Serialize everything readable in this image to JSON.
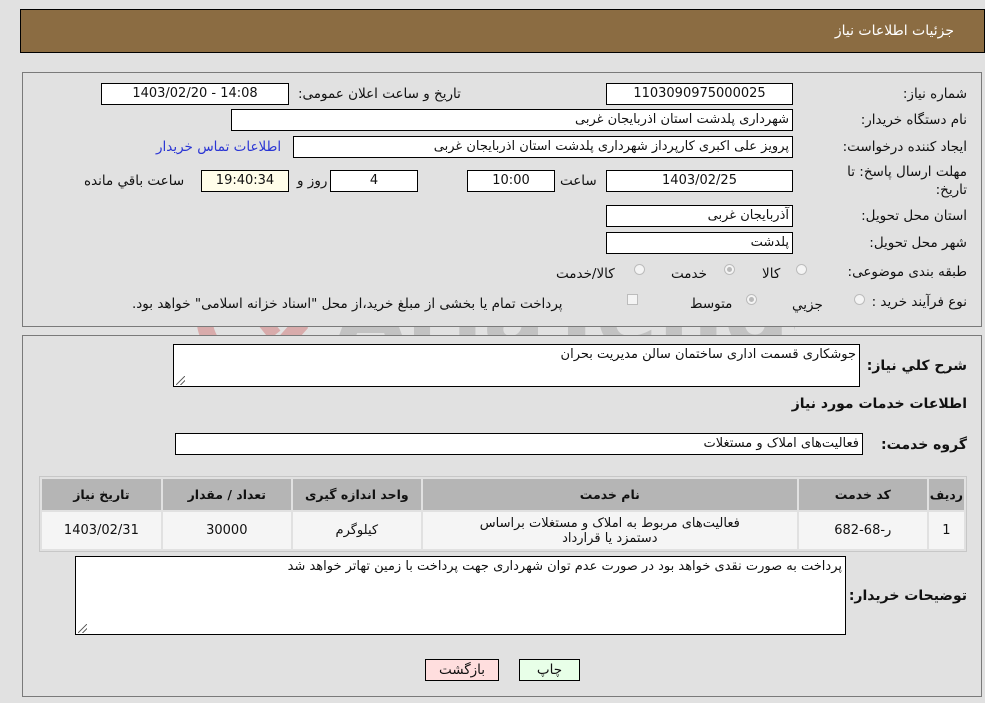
{
  "header": {
    "title": "جزئیات اطلاعات نیاز"
  },
  "form": {
    "need_number": {
      "label": "شماره نیاز:",
      "value": "1103090975000025"
    },
    "announce_datetime": {
      "label": "تاریخ و ساعت اعلان عمومی:",
      "value": "1403/02/20 - 14:08"
    },
    "buyer_org": {
      "label": "نام دستگاه خریدار:",
      "value": "شهرداری پلدشت استان اذربایجان غربی"
    },
    "requester": {
      "label": "ایجاد کننده درخواست:",
      "value": "پرویز علی اکبری کارپرداز شهرداری پلدشت استان اذربایجان غربی"
    },
    "buyer_contact_link": "اطلاعات تماس خریدار",
    "deadline": {
      "label": "مهلت ارسال پاسخ: تا تاریخ:",
      "date": "1403/02/25",
      "time_label": "ساعت",
      "time": "10:00",
      "days": "4",
      "days_label": "روز و",
      "remaining": "19:40:34",
      "remaining_label": "ساعت باقي مانده"
    },
    "province": {
      "label": "استان محل تحویل:",
      "value": "آذربایجان غربی"
    },
    "city": {
      "label": "شهر محل تحویل:",
      "value": "پلدشت"
    },
    "category": {
      "label": "طبقه بندی موضوعی:",
      "options": [
        "کالا",
        "خدمت",
        "کالا/خدمت"
      ],
      "selected": "خدمت"
    },
    "purchase_type": {
      "label": "نوع فرآیند خرید :",
      "options": [
        "جزيي",
        "متوسط"
      ],
      "selected": "متوسط",
      "treasury_note": "پرداخت تمام یا بخشی از مبلغ خرید،از محل \"اسناد خزانه اسلامی\" خواهد بود.",
      "treasury_checked": false
    }
  },
  "details": {
    "description_label": "شرح کلي نیاز:",
    "description": "جوشکاری قسمت اداری ساختمان سالن مدیریت بحران",
    "services_title": "اطلاعات خدمات مورد نیاز",
    "service_group_label": "گروه خدمت:",
    "service_group": "فعالیت‌های  املاک و مستغلات",
    "table": {
      "headers": [
        "ردیف",
        "کد خدمت",
        "نام خدمت",
        "واحد اندازه گیری",
        "تعداد / مقدار",
        "تاریخ نیاز"
      ],
      "rows": [
        [
          "1",
          "ر-68-682",
          "فعالیت‌های مربوط به املاک و مستغلات براساس دستمزد یا قرارداد",
          "کیلوگرم",
          "30000",
          "1403/02/31"
        ]
      ]
    },
    "buyer_notes_label": "توضیحات خریدار:",
    "buyer_notes": "پرداخت به صورت نقدی خواهد بود در صورت عدم توان شهرداری جهت پرداخت با زمین تهاتر خواهد شد"
  },
  "buttons": {
    "print": "چاپ",
    "back": "بازگشت"
  },
  "watermark": {
    "text": "AriaTender.net"
  }
}
